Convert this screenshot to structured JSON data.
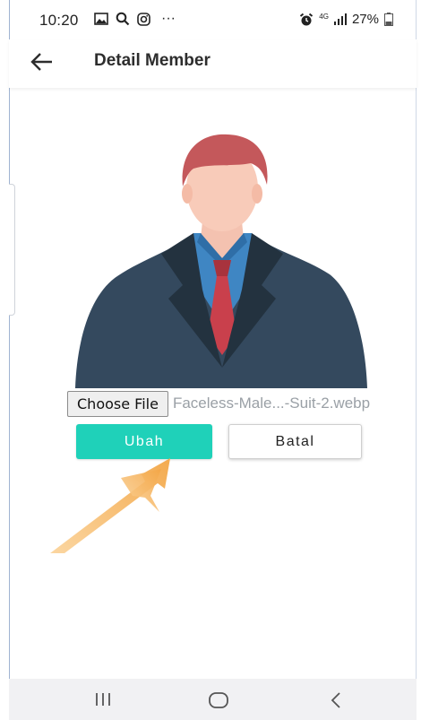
{
  "status_bar": {
    "time": "10:20",
    "left_icons": [
      "image-icon",
      "search-icon",
      "instagram-icon",
      "more-dots-icon"
    ],
    "more_dots": "···",
    "network": "4G",
    "battery": "27%"
  },
  "app_bar": {
    "title": "Detail Member"
  },
  "form": {
    "choose_file_label": "Choose File",
    "file_name": "Faceless-Male...-Suit-2.webp",
    "submit_label": "Ubah",
    "cancel_label": "Batal"
  },
  "colors": {
    "accent": "#1fd1b9",
    "annotation_arrow": "#f6b25c"
  }
}
